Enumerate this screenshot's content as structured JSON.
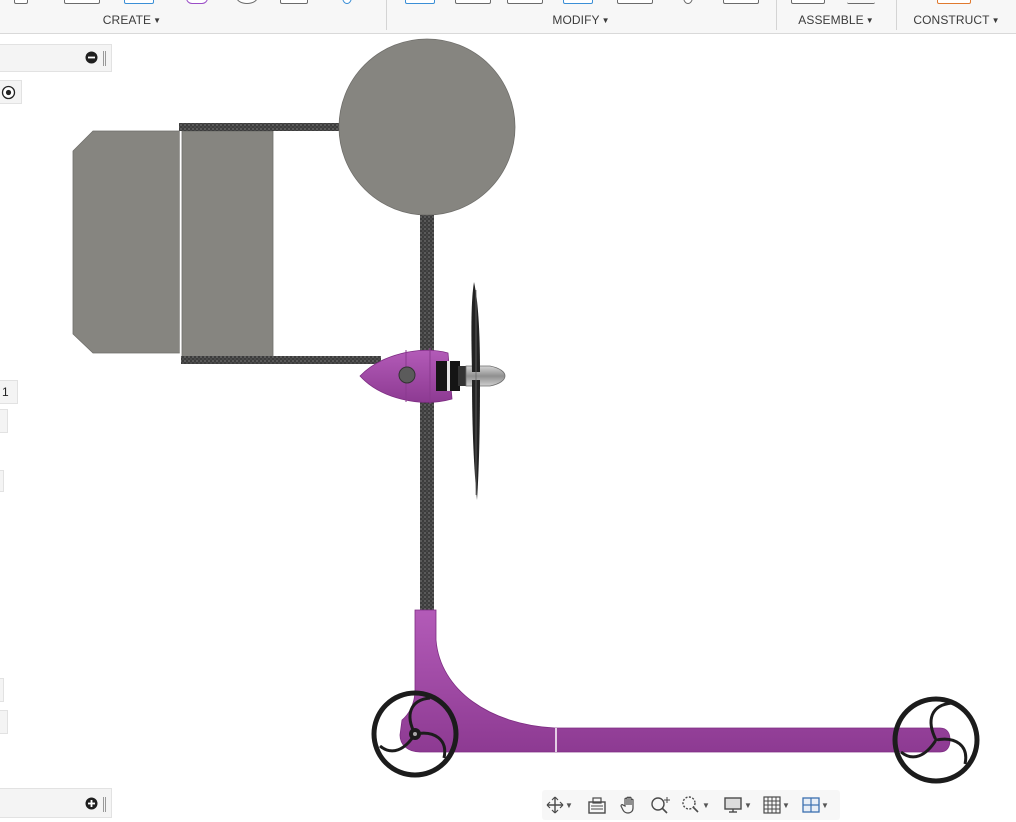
{
  "toolbar": {
    "groups": [
      {
        "label": "CREATE"
      },
      {
        "label": "MODIFY"
      },
      {
        "label": "ASSEMBLE"
      },
      {
        "label": "CONSTRUCT"
      }
    ],
    "caret": "▼"
  },
  "left_panel": {
    "row_value": "1",
    "collapse_icon": "minus-circle-icon",
    "expand_icon": "plus-circle-icon",
    "radio_icon": "radio-selected-icon"
  },
  "model": {
    "name": "propeller scooter",
    "colors": {
      "panel_gray": "#868580",
      "rod_dark": "#3c3c3c",
      "frame_purple": "#a347a8",
      "frame_purple_dark": "#7d2c82",
      "wheel_black": "#1c1c1c",
      "propeller_black": "#222222",
      "spinner_silver": "#a9a9a9"
    }
  },
  "navbar": {
    "items": [
      {
        "icon": "orbit-icon",
        "dropdown": true
      },
      {
        "icon": "look-at-icon",
        "dropdown": false
      },
      {
        "icon": "pan-hand-icon",
        "dropdown": false
      },
      {
        "icon": "zoom-icon",
        "dropdown": false
      },
      {
        "icon": "zoom-window-icon",
        "dropdown": true
      },
      {
        "icon": "display-settings-icon",
        "dropdown": true
      },
      {
        "icon": "grid-settings-icon",
        "dropdown": true
      },
      {
        "icon": "viewports-icon",
        "dropdown": true
      }
    ]
  }
}
